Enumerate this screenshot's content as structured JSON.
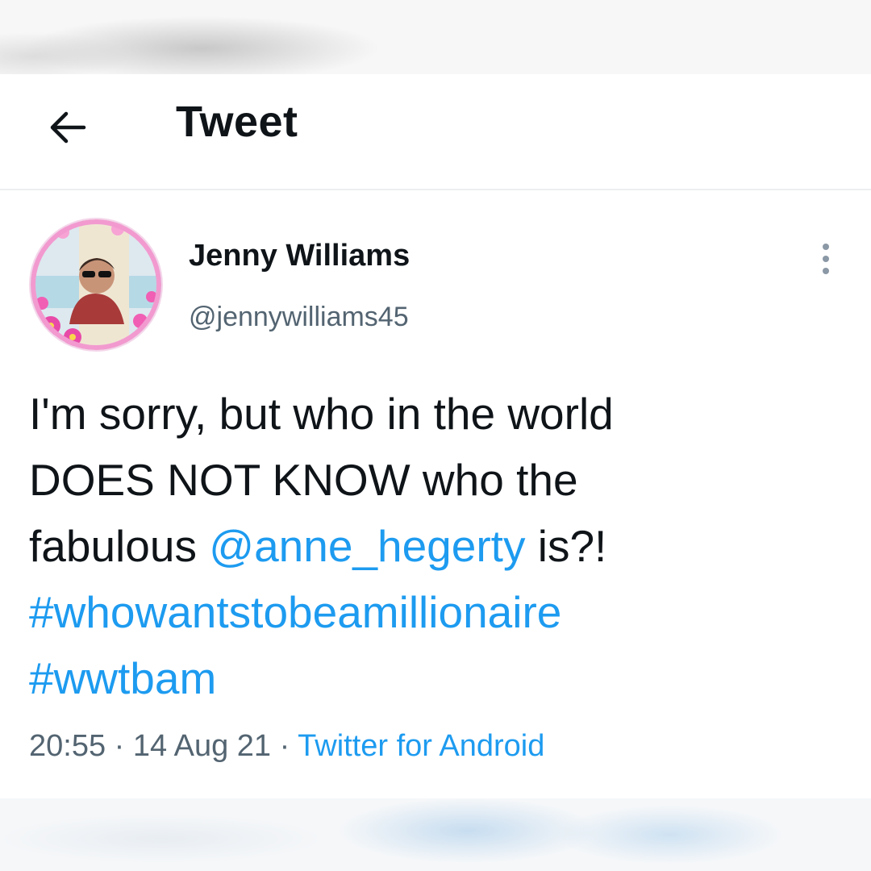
{
  "header": {
    "title": "Tweet",
    "back_icon": "arrow-left-icon"
  },
  "tweet": {
    "display_name": "Jenny Williams",
    "handle": "@jennywilliams45",
    "more_icon": "vertical-ellipsis-icon",
    "text": {
      "line1": "I'm sorry, but who in the world",
      "line2": "DOES NOT KNOW who the",
      "line3_prefix": "fabulous ",
      "mention": "@anne_hegerty",
      "line3_suffix": " is?!",
      "hashtag1": "#whowantstobeamillionaire",
      "hashtag2": "#wwtbam"
    },
    "meta": {
      "time": "20:55",
      "sep1": " · ",
      "date": "14 Aug 21",
      "sep2": " · ",
      "source": "Twitter for Android"
    }
  },
  "colors": {
    "link": "#1d9bf0",
    "text": "#0f1419",
    "secondary": "#536471"
  }
}
